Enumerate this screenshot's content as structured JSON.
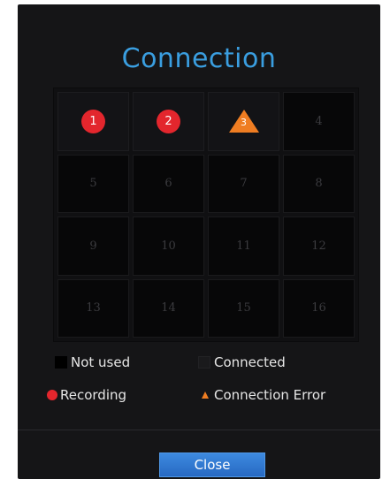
{
  "dialog": {
    "title": "Connection",
    "title_color": "#3a9ee0"
  },
  "channels": [
    {
      "number": "1",
      "status": "recording"
    },
    {
      "number": "2",
      "status": "recording"
    },
    {
      "number": "3",
      "status": "connection-error"
    },
    {
      "number": "4",
      "status": "connected"
    },
    {
      "number": "5",
      "status": "not-used"
    },
    {
      "number": "6",
      "status": "not-used"
    },
    {
      "number": "7",
      "status": "not-used"
    },
    {
      "number": "8",
      "status": "not-used"
    },
    {
      "number": "9",
      "status": "not-used"
    },
    {
      "number": "10",
      "status": "not-used"
    },
    {
      "number": "11",
      "status": "not-used"
    },
    {
      "number": "12",
      "status": "not-used"
    },
    {
      "number": "13",
      "status": "not-used"
    },
    {
      "number": "14",
      "status": "not-used"
    },
    {
      "number": "15",
      "status": "not-used"
    },
    {
      "number": "16",
      "status": "not-used"
    }
  ],
  "legend": {
    "not_used": "Not used",
    "connected": "Connected",
    "recording": "Recording",
    "connection_error": "Connection Error"
  },
  "colors": {
    "recording": "#e3262d",
    "connection_error": "#ef7d22",
    "button": "#2f78d0"
  },
  "buttons": {
    "close": "Close"
  }
}
